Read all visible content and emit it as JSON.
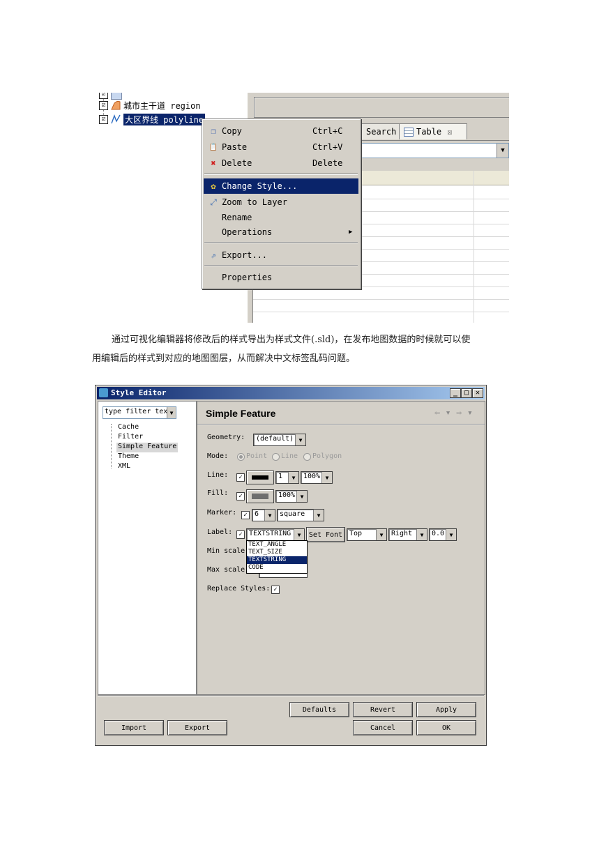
{
  "shot1": {
    "tree": [
      {
        "label": "城市主干道 region",
        "checked": "☑",
        "icon": "region-layer-icon"
      },
      {
        "label": "大区界线 polyline",
        "checked": "☑",
        "icon": "polyline-layer-icon"
      }
    ],
    "tabs": [
      {
        "label": "Search"
      },
      {
        "label": "Table",
        "close": "☒"
      }
    ],
    "context_menu": [
      {
        "label": "Copy",
        "shortcut": "Ctrl+C",
        "icon": "copy-icon",
        "glyph": "❐"
      },
      {
        "label": "Paste",
        "shortcut": "Ctrl+V",
        "icon": "paste-icon",
        "glyph": "📋"
      },
      {
        "label": "Delete",
        "shortcut": "Delete",
        "icon": "delete-icon",
        "glyph": "✖"
      },
      {
        "label": "Change Style...",
        "shortcut": "",
        "icon": "palette-icon",
        "glyph": "✿",
        "highlighted": true
      },
      {
        "label": "Zoom to Layer",
        "shortcut": "",
        "icon": "zoom-layer-icon",
        "glyph": "⤢"
      },
      {
        "label": "Rename",
        "shortcut": "",
        "icon": "",
        "glyph": ""
      },
      {
        "label": "Operations",
        "shortcut": "",
        "icon": "",
        "glyph": "",
        "submenu": "▶"
      },
      {
        "label": "Export...",
        "shortcut": "",
        "icon": "export-icon",
        "glyph": "⇗"
      },
      {
        "label": "Properties",
        "shortcut": "",
        "icon": "",
        "glyph": ""
      }
    ],
    "combo_arrow": "▼"
  },
  "paragraph": {
    "line1": "通过可视化编辑器将修改后的样式导出为样式文件(.sld)，在发布地图数据的时候就可以使",
    "line2": "用编辑后的样式到对应的地图图层，从而解决中文标签乱码问题。"
  },
  "style_editor": {
    "title": "Style Editor",
    "window_buttons": {
      "minimize": "_",
      "maximize": "□",
      "close": "✕"
    },
    "filter_text": "type filter text",
    "nav": [
      "Cache",
      "Filter",
      "Simple Feature",
      "Theme",
      "XML"
    ],
    "nav_selected": "Simple Feature",
    "panel_title": "Simple Feature",
    "nav_arrows": "⇦ ▾ ⇨ ▾",
    "fields": {
      "geometry": {
        "label": "Geometry:",
        "value": "(default)"
      },
      "mode": {
        "label": "Mode:",
        "options": [
          "Point",
          "Line",
          "Polygon"
        ],
        "selected": "Point"
      },
      "line": {
        "label": "Line:",
        "width": "1",
        "opacity": "100%",
        "color": "#000000"
      },
      "fill": {
        "label": "Fill:",
        "opacity": "100%",
        "color": "#6e6e6e"
      },
      "marker": {
        "label": "Marker:",
        "size": "6",
        "shape": "square"
      },
      "label": {
        "label": "Label:",
        "field": "TEXTSTRING",
        "set_font": "Set Font",
        "vpos": "Top",
        "hpos": "Right",
        "rotation": "0.0"
      },
      "min_scale": {
        "label": "Min scale:"
      },
      "max_scale": {
        "label": "Max scale:"
      },
      "replace_styles": {
        "label": "Replace Styles:"
      }
    },
    "dropdown_options": [
      "TEXT_ANGLE",
      "TEXT_SIZE",
      "TEXTSTRING",
      "CODE"
    ],
    "dropdown_selected": "TEXTSTRING",
    "check": "✓",
    "buttons": {
      "defaults": "Defaults",
      "revert": "Revert",
      "apply": "Apply",
      "import": "Import",
      "export": "Export",
      "cancel": "Cancel",
      "ok": "OK"
    }
  }
}
